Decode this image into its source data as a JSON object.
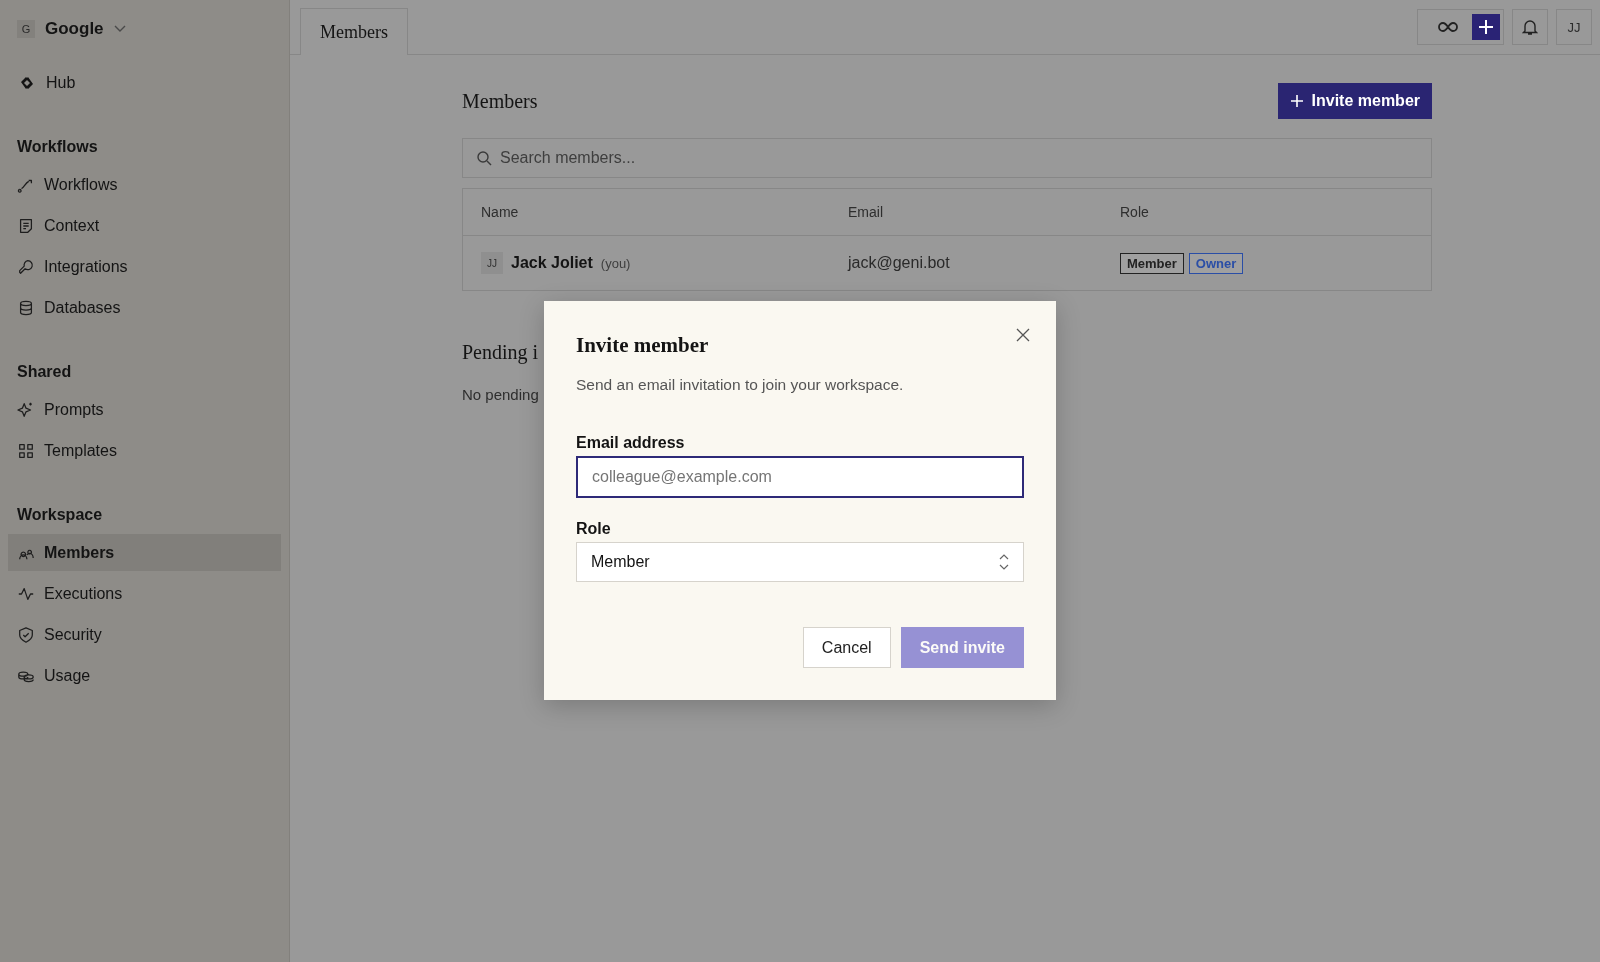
{
  "workspace": {
    "initial": "G",
    "name": "Google"
  },
  "hub": {
    "label": "Hub",
    "selected": false
  },
  "sidebar": {
    "sections": [
      {
        "title": "Workflows",
        "items": [
          {
            "label": "Workflows",
            "selected": false
          },
          {
            "label": "Context",
            "selected": false
          },
          {
            "label": "Integrations",
            "selected": false
          },
          {
            "label": "Databases",
            "selected": false
          }
        ]
      },
      {
        "title": "Shared",
        "items": [
          {
            "label": "Prompts",
            "selected": false
          },
          {
            "label": "Templates",
            "selected": false
          }
        ]
      },
      {
        "title": "Workspace",
        "items": [
          {
            "label": "Members",
            "selected": true
          },
          {
            "label": "Executions",
            "selected": false
          },
          {
            "label": "Security",
            "selected": false
          },
          {
            "label": "Usage",
            "selected": false
          }
        ]
      }
    ]
  },
  "tabs": [
    {
      "label": "Members",
      "selected": true
    }
  ],
  "toolbar": {
    "avatar": "JJ"
  },
  "page": {
    "title": "Members",
    "invite_button": "Invite member",
    "search": {
      "placeholder": "Search members..."
    },
    "table": {
      "columns": [
        "Name",
        "Email",
        "Role"
      ],
      "rows": [
        {
          "initials": "JJ",
          "name": "Jack Joliet",
          "note": "(you)",
          "email": "jack@geni.bot",
          "roles": [
            {
              "label": "Member",
              "color": "#222222"
            },
            {
              "label": "Owner",
              "color": "#2a4ea6"
            }
          ]
        }
      ]
    },
    "pending_title": "Pending i",
    "pending_empty": "No pending"
  },
  "dialog": {
    "title": "Invite member",
    "description": "Send an email invitation to join your workspace.",
    "email_label": "Email address",
    "email_placeholder": "colleague@example.com",
    "role_label": "Role",
    "role_value": "Member",
    "cancel": "Cancel",
    "submit": {
      "label": "Send invite",
      "disabled": true
    }
  }
}
